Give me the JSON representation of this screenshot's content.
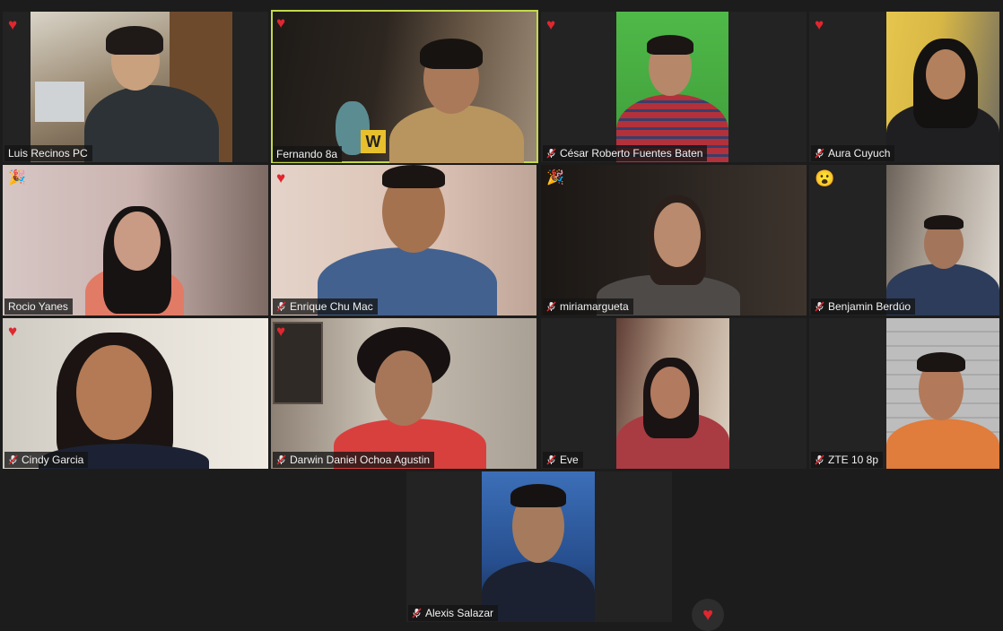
{
  "participants": [
    {
      "name": "Luis Recinos PC",
      "muted": false,
      "reaction": "♥"
    },
    {
      "name": "Fernando 8a",
      "muted": false,
      "reaction": "♥"
    },
    {
      "name": "César Roberto Fuentes Baten",
      "muted": true,
      "reaction": "♥"
    },
    {
      "name": "Aura Cuyuch",
      "muted": true,
      "reaction": "♥"
    },
    {
      "name": "Rocio Yanes",
      "muted": false,
      "reaction": "🎉"
    },
    {
      "name": "Enrique Chu Mac",
      "muted": true,
      "reaction": "♥"
    },
    {
      "name": "miriamargueta",
      "muted": true,
      "reaction": "🎉"
    },
    {
      "name": "Benjamin Berdúo",
      "muted": true,
      "reaction": "😮"
    },
    {
      "name": "Cindy Garcia",
      "muted": true,
      "reaction": "♥"
    },
    {
      "name": "Darwin Daniel Ochoa Agustin",
      "muted": true,
      "reaction": "♥"
    },
    {
      "name": "Eve",
      "muted": true,
      "reaction": ""
    },
    {
      "name": "ZTE 10 8p",
      "muted": true,
      "reaction": ""
    },
    {
      "name": "Alexis Salazar",
      "muted": true,
      "reaction": ""
    }
  ],
  "overlay": {
    "W": "W"
  },
  "reactions_button": "♥",
  "colors": {
    "active_speaker": "#c3d94a",
    "heart": "#e0262f",
    "background": "#1c1c1c"
  }
}
